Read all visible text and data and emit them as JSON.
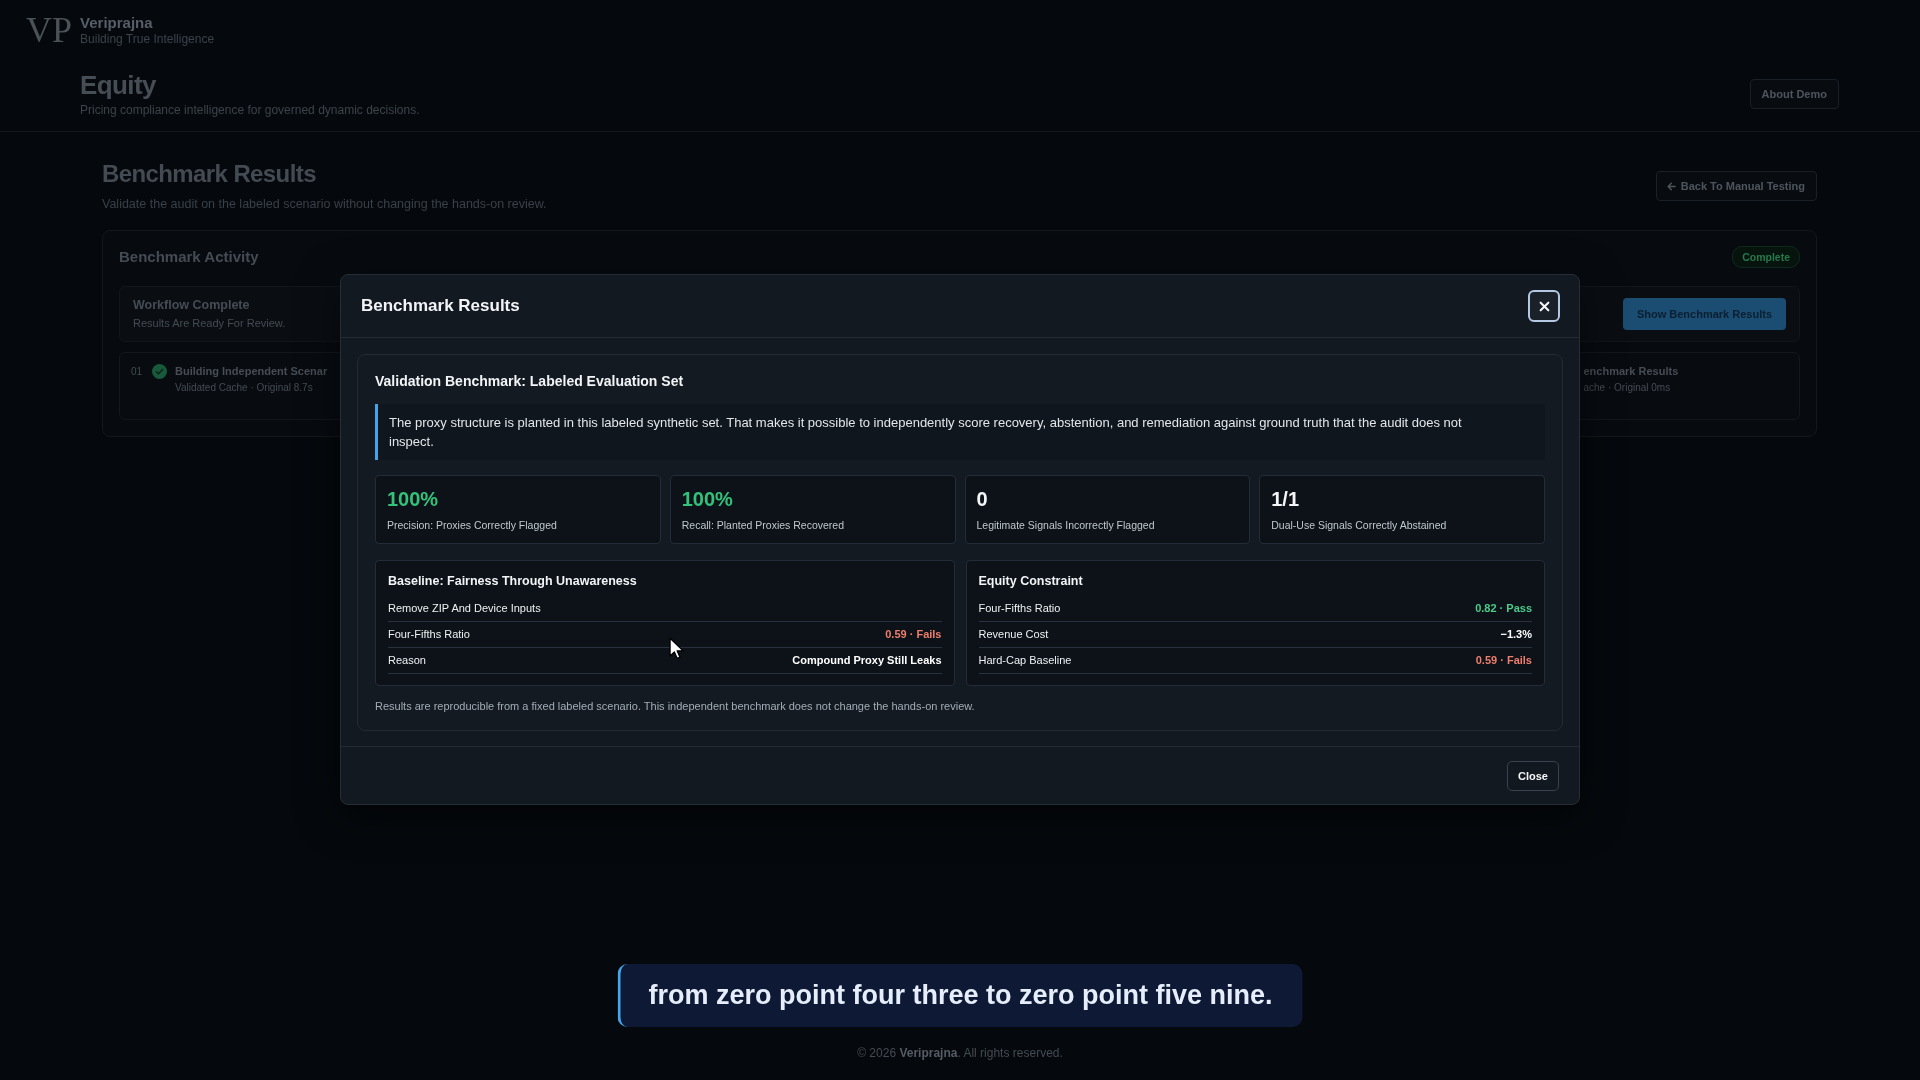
{
  "brand": {
    "logo_mark": "VP",
    "name": "Veriprajna",
    "tagline": "Building True Intelligence"
  },
  "page_header": {
    "title": "Equity",
    "subtitle": "Pricing compliance intelligence for governed dynamic decisions.",
    "about_button": "About Demo"
  },
  "section": {
    "title": "Benchmark Results",
    "subtitle": "Validate the audit on the labeled scenario without changing the hands-on review.",
    "back_button": "Back To Manual Testing"
  },
  "activity": {
    "title": "Benchmark Activity",
    "status_badge": "Complete",
    "workflow": {
      "title": "Workflow Complete",
      "subtitle": "Results Are Ready For Review.",
      "button": "Show Benchmark Results"
    },
    "steps": [
      {
        "number": "01",
        "done": true,
        "title": "Building Independent Scenar",
        "detail": "Validated Cache · Original 8.7s"
      },
      {
        "title": "enchmark Results",
        "detail": "ache · Original 0ms"
      }
    ]
  },
  "modal": {
    "title": "Benchmark Results",
    "panel_title": "Validation Benchmark: Labeled Evaluation Set",
    "note": "The proxy structure is planted in this labeled synthetic set. That makes it possible to independently score recovery, abstention, and remediation against ground truth that the audit does not inspect.",
    "metrics": [
      {
        "value": "100%",
        "label": "Precision: Proxies Correctly Flagged",
        "color": "#32c27a"
      },
      {
        "value": "100%",
        "label": "Recall: Planted Proxies Recovered",
        "color": "#32c27a"
      },
      {
        "value": "0",
        "label": "Legitimate Signals Incorrectly Flagged",
        "color": "#f4f6f8"
      },
      {
        "value": "1/1",
        "label": "Dual-Use Signals Correctly Abstained",
        "color": "#f4f6f8"
      }
    ],
    "comparisons": [
      {
        "title": "Baseline: Fairness Through Unawareness",
        "rows": [
          {
            "label": "Remove ZIP And Device Inputs"
          },
          {
            "label": "Four-Fifths Ratio",
            "value": "0.59 · Fails",
            "color": "#f07e6c"
          },
          {
            "label": "Reason",
            "value": "Compound Proxy Still Leaks",
            "color": "#ffffff"
          }
        ]
      },
      {
        "title": "Equity Constraint",
        "rows": [
          {
            "label": "Four-Fifths Ratio",
            "value": "0.82 · Pass",
            "color": "#4ccb8a"
          },
          {
            "label": "Revenue Cost",
            "value": "−1.3%",
            "color": "#ffffff"
          },
          {
            "label": "Hard-Cap Baseline",
            "value": "0.59 · Fails",
            "color": "#f07e6c"
          }
        ]
      }
    ],
    "footnote": "Results are reproducible from a fixed labeled scenario. This independent benchmark does not change the hands-on review.",
    "close_button": "Close"
  },
  "caption": "from zero point four three to zero point five nine.",
  "footer": "© 2026 **Veriprajna**. All rights reserved."
}
